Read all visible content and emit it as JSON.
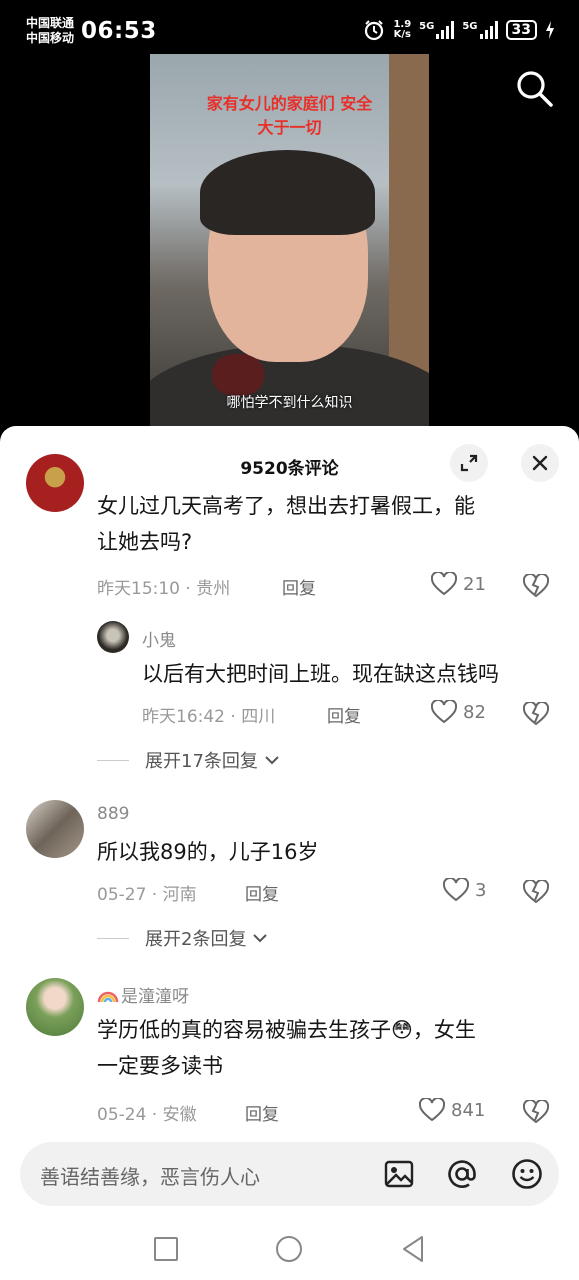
{
  "status": {
    "carrier1": "中国联通",
    "carrier2": "中国移动",
    "time": "06:53",
    "speed_value": "1.9",
    "speed_unit": "K/s",
    "net1": "5G",
    "net2": "5G",
    "battery": "33"
  },
  "video": {
    "caption_top_line1": "家有女儿的家庭们 安全",
    "caption_top_line2": "大于一切",
    "subtitle": "哪怕学不到什么知识"
  },
  "comments_panel": {
    "title": "9520条评论",
    "reply_label": "回复",
    "comments": [
      {
        "text_line1": "女儿过几天高考了，想出去打暑假工，能",
        "text_line2": "让她去吗?",
        "meta": "昨天15:10 · 贵州",
        "likes": "21",
        "reply": {
          "name": "小鬼",
          "text": "以后有大把时间上班。现在缺这点钱吗",
          "meta": "昨天16:42 · 四川",
          "likes": "82"
        },
        "expand": "展开17条回复"
      },
      {
        "name": "889",
        "text_line1": "所以我89的，儿子16岁",
        "meta": "05-27 · 河南",
        "likes": "3",
        "expand": "展开2条回复"
      },
      {
        "name": "是潼潼呀",
        "text_line1": "学历低的真的容易被骗去生孩子",
        "text_emoji": "😳",
        "text_line1b": "，女生",
        "text_line2": "一定要多读书",
        "meta": "05-24 · 安徽",
        "likes": "841"
      }
    ]
  },
  "input": {
    "placeholder": "善语结善缘，恶言伤人心"
  },
  "icons": {
    "search": "search-icon",
    "expand": "expand-icon",
    "close": "close-icon",
    "like": "heart-icon",
    "dislike": "broken-heart-icon",
    "image": "image-icon",
    "mention": "at-icon",
    "emoji": "emoji-icon",
    "rainbow": "rainbow-icon"
  },
  "colors": {
    "caption_red": "#e8302a",
    "meta_gray": "#999999",
    "panel_bg": "#ffffff"
  }
}
